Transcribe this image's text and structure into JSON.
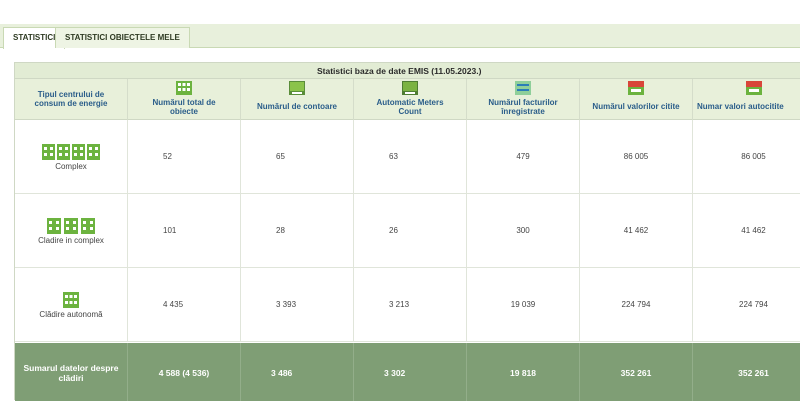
{
  "tabs": [
    {
      "label": "STATISTICI",
      "active": true
    },
    {
      "label": "STATISTICI OBIECTELE MELE",
      "active": false
    }
  ],
  "table": {
    "title": "Statistici baza de date EMIS (11.05.2023.)",
    "headers": [
      {
        "label": "Tipul centrului de consum de energie",
        "icon": ""
      },
      {
        "label": "Numărul total de obiecte",
        "icon": "building-grid-icon"
      },
      {
        "label": "Numărul de contoare",
        "icon": "meter-icon"
      },
      {
        "label": "Automatic Meters Count",
        "icon": "automatic-meter-icon"
      },
      {
        "label": "Numărul facturilor înregistrate",
        "icon": "invoice-icon"
      },
      {
        "label": "Numărul valorilor citite",
        "icon": "readings-icon"
      },
      {
        "label": "Numar valori autocitite",
        "icon": "auto-readings-icon"
      }
    ],
    "rows": [
      {
        "type": "Complex",
        "icon": "complex-buildings-icon",
        "values": [
          "52",
          "65",
          "63",
          "479",
          "86 005",
          "86 005"
        ]
      },
      {
        "type": "Cladire in complex",
        "icon": "building-in-complex-icon",
        "values": [
          "101",
          "28",
          "26",
          "300",
          "41 462",
          "41 462"
        ]
      },
      {
        "type": "Clădire autonomă",
        "icon": "standalone-building-icon",
        "values": [
          "4 435",
          "3 393",
          "3 213",
          "19 039",
          "224 794",
          "224 794"
        ]
      }
    ],
    "summary": {
      "label": "Sumarul datelor despre clădiri",
      "values": [
        "4 588 (4 536)",
        "3 486",
        "3 302",
        "19 818",
        "352 261",
        "352 261"
      ]
    }
  },
  "colors": {
    "accent_green": "#7f9e75",
    "header_text": "#2a5d8a",
    "header_bg": "#e8f0da",
    "icon_green": "#6cb33f",
    "icon_red": "#d9453a"
  }
}
